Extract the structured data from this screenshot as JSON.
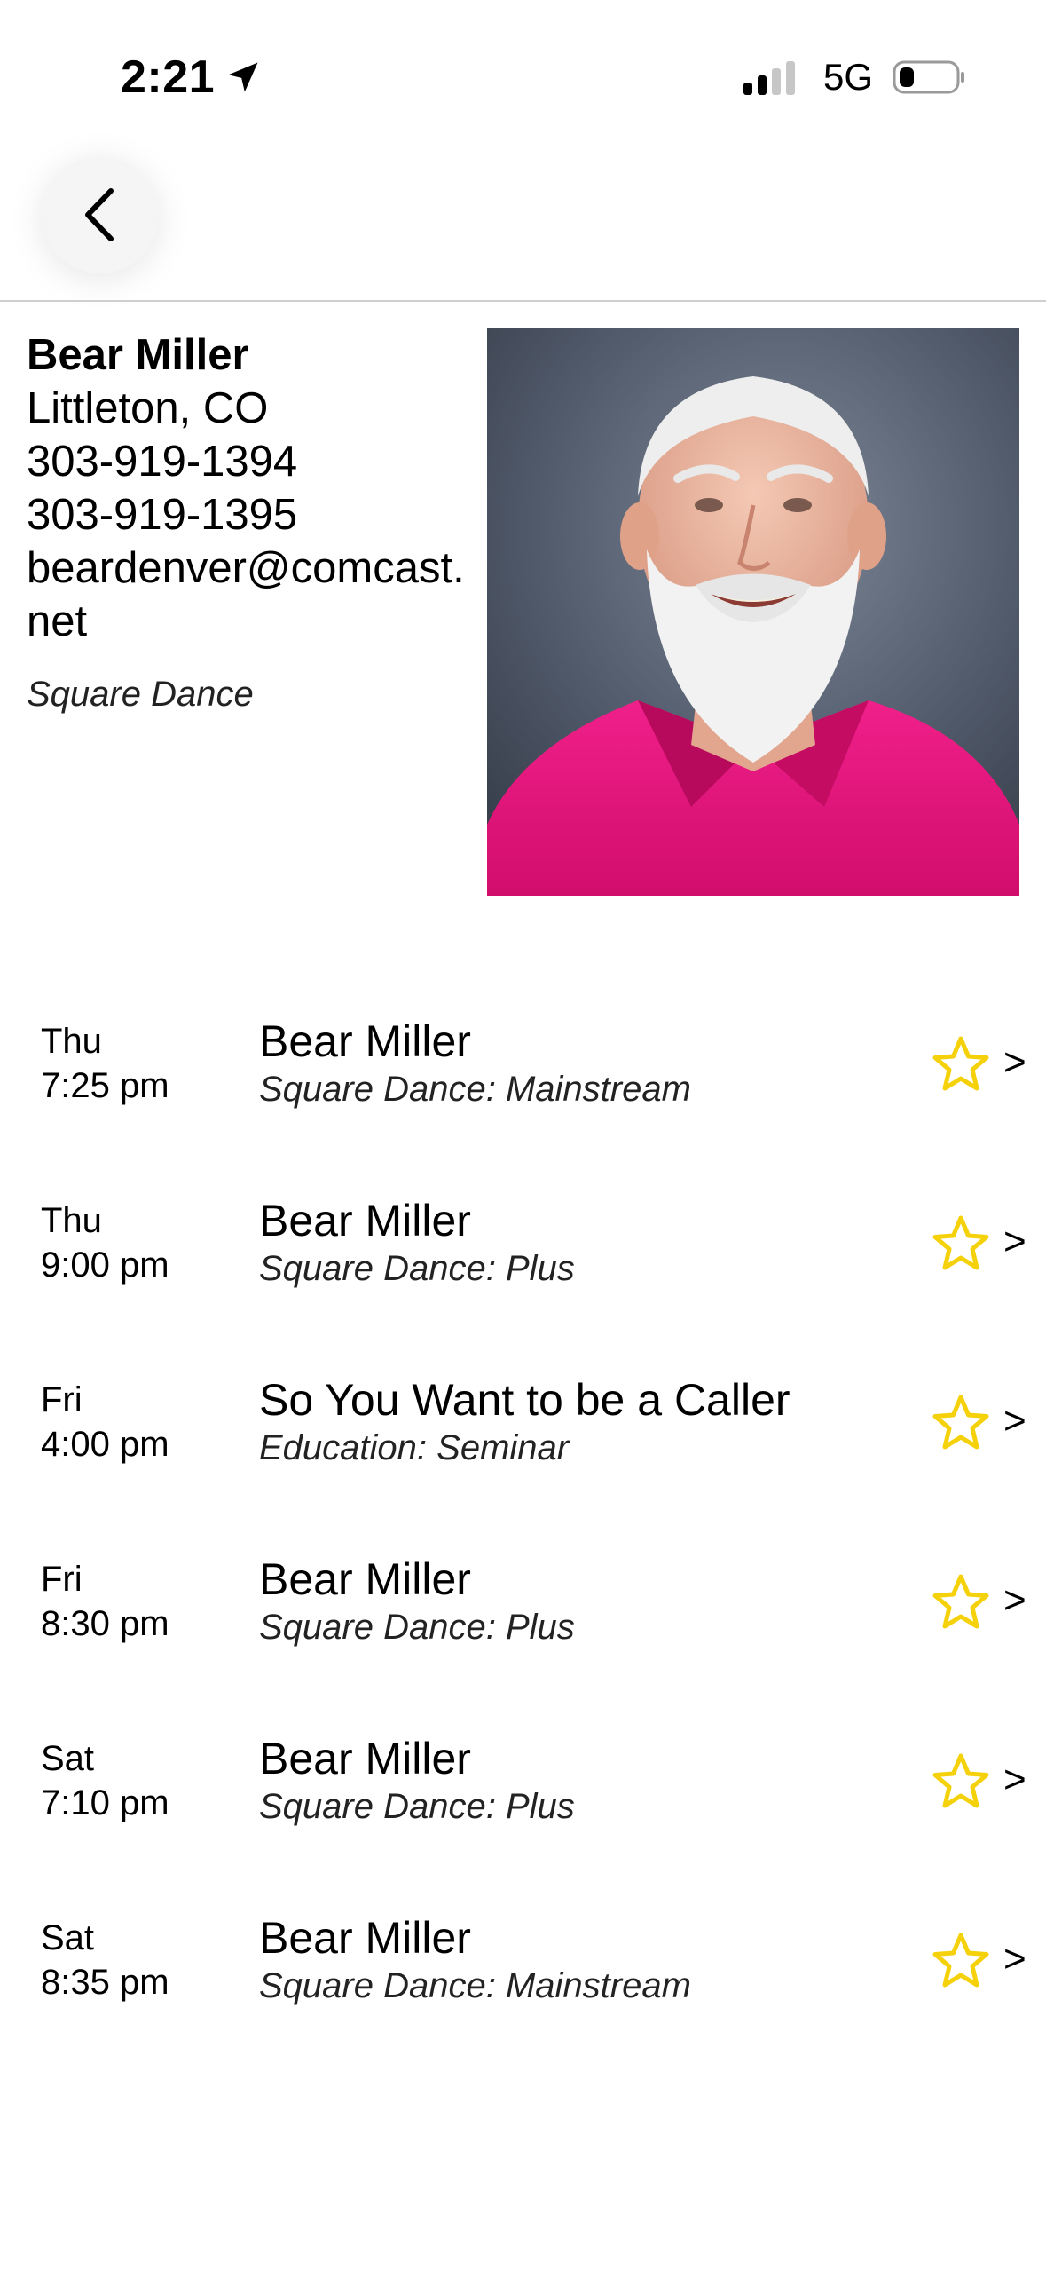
{
  "status_bar": {
    "time": "2:21",
    "network": "5G",
    "icons": [
      "location-arrow-icon",
      "signal-bars-icon",
      "battery-icon"
    ]
  },
  "header": {
    "back_icon": "chevron-left-icon"
  },
  "profile": {
    "name": "Bear Miller",
    "location": "Littleton, CO",
    "phone_1": "303-919-1394",
    "phone_2": "303-919-1395",
    "email": "beardenver@comcast.net",
    "category": "Square Dance"
  },
  "schedule": [
    {
      "day": "Thu",
      "time": "7:25 pm",
      "title": "Bear Miller",
      "subtitle": "Square Dance: Mainstream"
    },
    {
      "day": "Thu",
      "time": "9:00 pm",
      "title": "Bear Miller",
      "subtitle": "Square Dance: Plus"
    },
    {
      "day": "Fri",
      "time": "4:00 pm",
      "title": "So You Want to be a Caller",
      "subtitle": "Education: Seminar"
    },
    {
      "day": "Fri",
      "time": "8:30 pm",
      "title": "Bear Miller",
      "subtitle": "Square Dance: Plus"
    },
    {
      "day": "Sat",
      "time": "7:10 pm",
      "title": "Bear Miller",
      "subtitle": "Square Dance: Plus"
    },
    {
      "day": "Sat",
      "time": "8:35 pm",
      "title": "Bear Miller",
      "subtitle": "Square Dance: Mainstream"
    }
  ],
  "row_chevron": ">",
  "colors": {
    "star": "#f5d10a",
    "divider": "#cfcfcf",
    "photo_shirt": "#e8127a"
  }
}
